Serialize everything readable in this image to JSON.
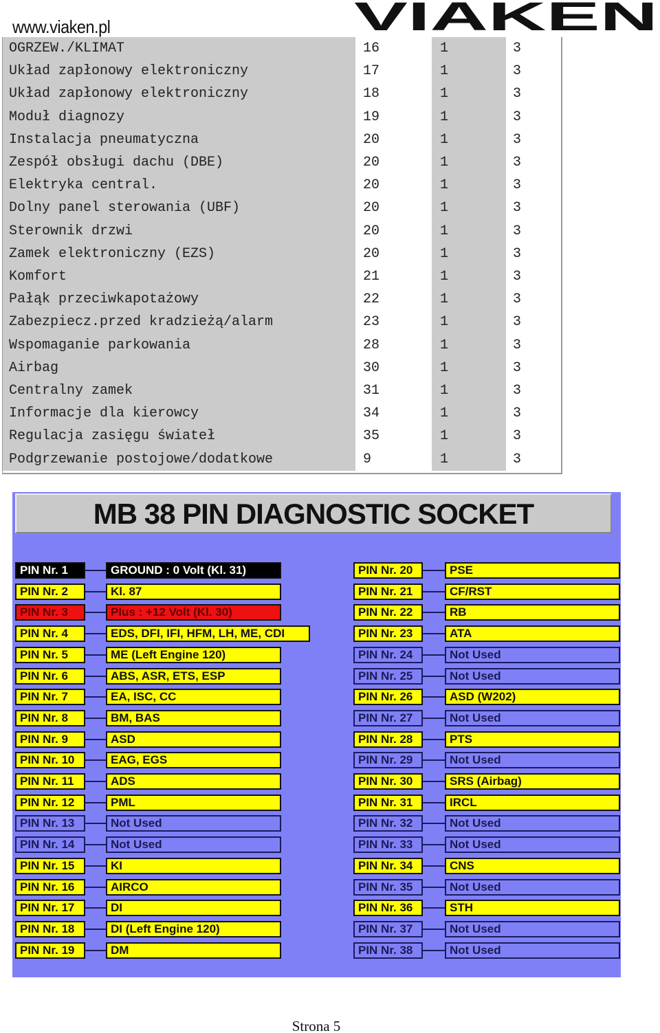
{
  "header": {
    "site": "www.viaken.pl",
    "logo": "VIAKEN"
  },
  "table": {
    "rows": [
      [
        "OGRZEW./KLIMAT",
        "16",
        "1",
        "3"
      ],
      [
        "Układ zapłonowy elektroniczny",
        "17",
        "1",
        "3"
      ],
      [
        "Układ zapłonowy elektroniczny",
        "18",
        "1",
        "3"
      ],
      [
        "Moduł diagnozy",
        "19",
        "1",
        "3"
      ],
      [
        "Instalacja pneumatyczna",
        "20",
        "1",
        "3"
      ],
      [
        "Zespół obsługi dachu (DBE)",
        "20",
        "1",
        "3"
      ],
      [
        "Elektryka central.",
        "20",
        "1",
        "3"
      ],
      [
        "Dolny panel sterowania (UBF)",
        "20",
        "1",
        "3"
      ],
      [
        "Sterownik drzwi",
        "20",
        "1",
        "3"
      ],
      [
        "Zamek elektroniczny (EZS)",
        "20",
        "1",
        "3"
      ],
      [
        "Komfort",
        "21",
        "1",
        "3"
      ],
      [
        "Pałąk przeciwkapotażowy",
        "22",
        "1",
        "3"
      ],
      [
        "Zabezpiecz.przed kradzieżą/alarm",
        "23",
        "1",
        "3"
      ],
      [
        "Wspomaganie parkowania",
        "28",
        "1",
        "3"
      ],
      [
        "Airbag",
        "30",
        "1",
        "3"
      ],
      [
        "Centralny zamek",
        "31",
        "1",
        "3"
      ],
      [
        "Informacje dla kierowcy",
        "34",
        "1",
        "3"
      ],
      [
        "Regulacja zasięgu świateł",
        "35",
        "1",
        "3"
      ],
      [
        "Podgrzewanie postojowe/dodatkowe",
        "9",
        "1",
        "3"
      ]
    ]
  },
  "diagram": {
    "title": "MB 38 PIN DIAGNOSTIC SOCKET",
    "colors": {
      "background": "#8080f6",
      "used": "#ffff00",
      "ground": "#000000",
      "plus": "#ee1111"
    },
    "pins": [
      {
        "pin": "PIN Nr. 1",
        "desc": "GROUND : 0 Volt (Kl. 31)",
        "state": "k"
      },
      {
        "pin": "PIN Nr. 2",
        "desc": "Kl. 87",
        "state": "y"
      },
      {
        "pin": "PIN Nr. 3",
        "desc": "Plus : +12 Volt (Kl. 30)",
        "state": "r"
      },
      {
        "pin": "PIN Nr. 4",
        "desc": "EDS, DFI, IFI, HFM, LH, ME, CDI",
        "state": "y"
      },
      {
        "pin": "PIN Nr. 5",
        "desc": "ME (Left Engine 120)",
        "state": "y"
      },
      {
        "pin": "PIN Nr. 6",
        "desc": "ABS, ASR, ETS, ESP",
        "state": "y"
      },
      {
        "pin": "PIN Nr. 7",
        "desc": "EA, ISC, CC",
        "state": "y"
      },
      {
        "pin": "PIN Nr. 8",
        "desc": "BM, BAS",
        "state": "y"
      },
      {
        "pin": "PIN Nr. 9",
        "desc": "ASD",
        "state": "y"
      },
      {
        "pin": "PIN Nr. 10",
        "desc": "EAG, EGS",
        "state": "y"
      },
      {
        "pin": "PIN Nr. 11",
        "desc": "ADS",
        "state": "y"
      },
      {
        "pin": "PIN Nr. 12",
        "desc": "PML",
        "state": "y"
      },
      {
        "pin": "PIN Nr. 13",
        "desc": "Not Used",
        "state": "u"
      },
      {
        "pin": "PIN Nr. 14",
        "desc": "Not Used",
        "state": "u"
      },
      {
        "pin": "PIN Nr. 15",
        "desc": "KI",
        "state": "y"
      },
      {
        "pin": "PIN Nr. 16",
        "desc": "AIRCO",
        "state": "y"
      },
      {
        "pin": "PIN Nr. 17",
        "desc": "DI",
        "state": "y"
      },
      {
        "pin": "PIN Nr. 18",
        "desc": "DI (Left Engine 120)",
        "state": "y"
      },
      {
        "pin": "PIN Nr. 19",
        "desc": "DM",
        "state": "y"
      },
      {
        "pin": "PIN Nr. 20",
        "desc": "PSE",
        "state": "y"
      },
      {
        "pin": "PIN Nr. 21",
        "desc": "CF/RST",
        "state": "y"
      },
      {
        "pin": "PIN Nr. 22",
        "desc": "RB",
        "state": "y"
      },
      {
        "pin": "PIN Nr. 23",
        "desc": "ATA",
        "state": "y"
      },
      {
        "pin": "PIN Nr. 24",
        "desc": "Not Used",
        "state": "u"
      },
      {
        "pin": "PIN Nr. 25",
        "desc": "Not Used",
        "state": "u"
      },
      {
        "pin": "PIN Nr. 26",
        "desc": "ASD (W202)",
        "state": "y"
      },
      {
        "pin": "PIN Nr. 27",
        "desc": "Not Used",
        "state": "u"
      },
      {
        "pin": "PIN Nr. 28",
        "desc": "PTS",
        "state": "y"
      },
      {
        "pin": "PIN Nr. 29",
        "desc": "Not Used",
        "state": "u"
      },
      {
        "pin": "PIN Nr. 30",
        "desc": "SRS (Airbag)",
        "state": "y"
      },
      {
        "pin": "PIN Nr. 31",
        "desc": "IRCL",
        "state": "y"
      },
      {
        "pin": "PIN Nr. 32",
        "desc": "Not Used",
        "state": "u"
      },
      {
        "pin": "PIN Nr. 33",
        "desc": "Not Used",
        "state": "u"
      },
      {
        "pin": "PIN Nr. 34",
        "desc": "CNS",
        "state": "y"
      },
      {
        "pin": "PIN Nr. 35",
        "desc": "Not Used",
        "state": "u"
      },
      {
        "pin": "PIN Nr. 36",
        "desc": "STH",
        "state": "y"
      },
      {
        "pin": "PIN Nr. 37",
        "desc": "Not Used",
        "state": "u"
      },
      {
        "pin": "PIN Nr. 38",
        "desc": "Not Used",
        "state": "u"
      }
    ]
  },
  "footer": {
    "page": "Strona 5"
  }
}
